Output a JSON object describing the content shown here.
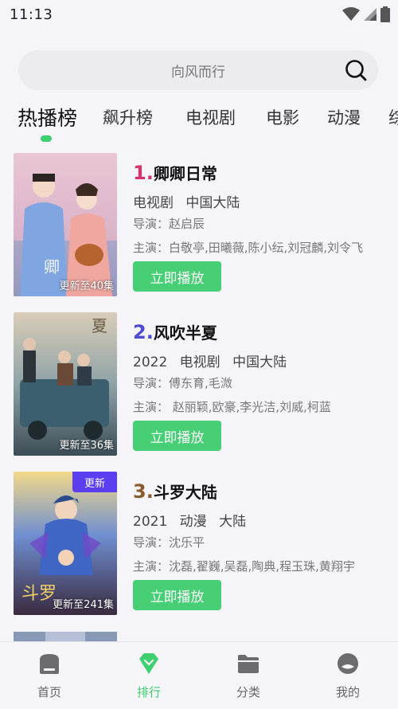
{
  "status": {
    "time": "11:13"
  },
  "search": {
    "placeholder": "向风而行"
  },
  "tabs": [
    {
      "label": "热播榜",
      "active": true
    },
    {
      "label": "飙升榜"
    },
    {
      "label": "电视剧"
    },
    {
      "label": "电影"
    },
    {
      "label": "动漫"
    },
    {
      "label": "综"
    }
  ],
  "list": [
    {
      "rank": "1.",
      "rank_color": "#d6336c",
      "title": "卿卿日常",
      "year": "",
      "type": "电视剧",
      "region": "中国大陆",
      "director": "导演：赵启辰",
      "cast": "主演：白敬亭,田曦薇,陈小纭,刘冠麟,刘令飞",
      "update": "更新至40集",
      "badge": "",
      "play_label": "立即播放"
    },
    {
      "rank": "2.",
      "rank_color": "#4b4bd6",
      "title": "风吹半夏",
      "year": "2022",
      "type": "电视剧",
      "region": "中国大陆",
      "director": "导演：傅东育,毛溦",
      "cast": "主演： 赵丽颖,欧豪,李光洁,刘威,柯蓝",
      "update": "更新至36集",
      "badge": "",
      "play_label": "立即播放"
    },
    {
      "rank": "3.",
      "rank_color": "#8a5a2b",
      "title": "斗罗大陆",
      "year": "2021",
      "type": "动漫",
      "region": "大陆",
      "director": "导演：沈乐平",
      "cast": "主演：沈磊,翟巍,吴磊,陶典,程玉珠,黄翔宇",
      "update": "更新至241集",
      "badge": "更新",
      "play_label": "立即播放"
    }
  ],
  "nav": [
    {
      "label": "首页",
      "icon": "home-icon"
    },
    {
      "label": "排行",
      "icon": "rank-icon",
      "active": true
    },
    {
      "label": "分类",
      "icon": "folder-icon"
    },
    {
      "label": "我的",
      "icon": "profile-icon"
    }
  ],
  "colors": {
    "accent": "#3ecf6e",
    "play_button": "#46cf74",
    "badge": "#5a3ef0"
  }
}
